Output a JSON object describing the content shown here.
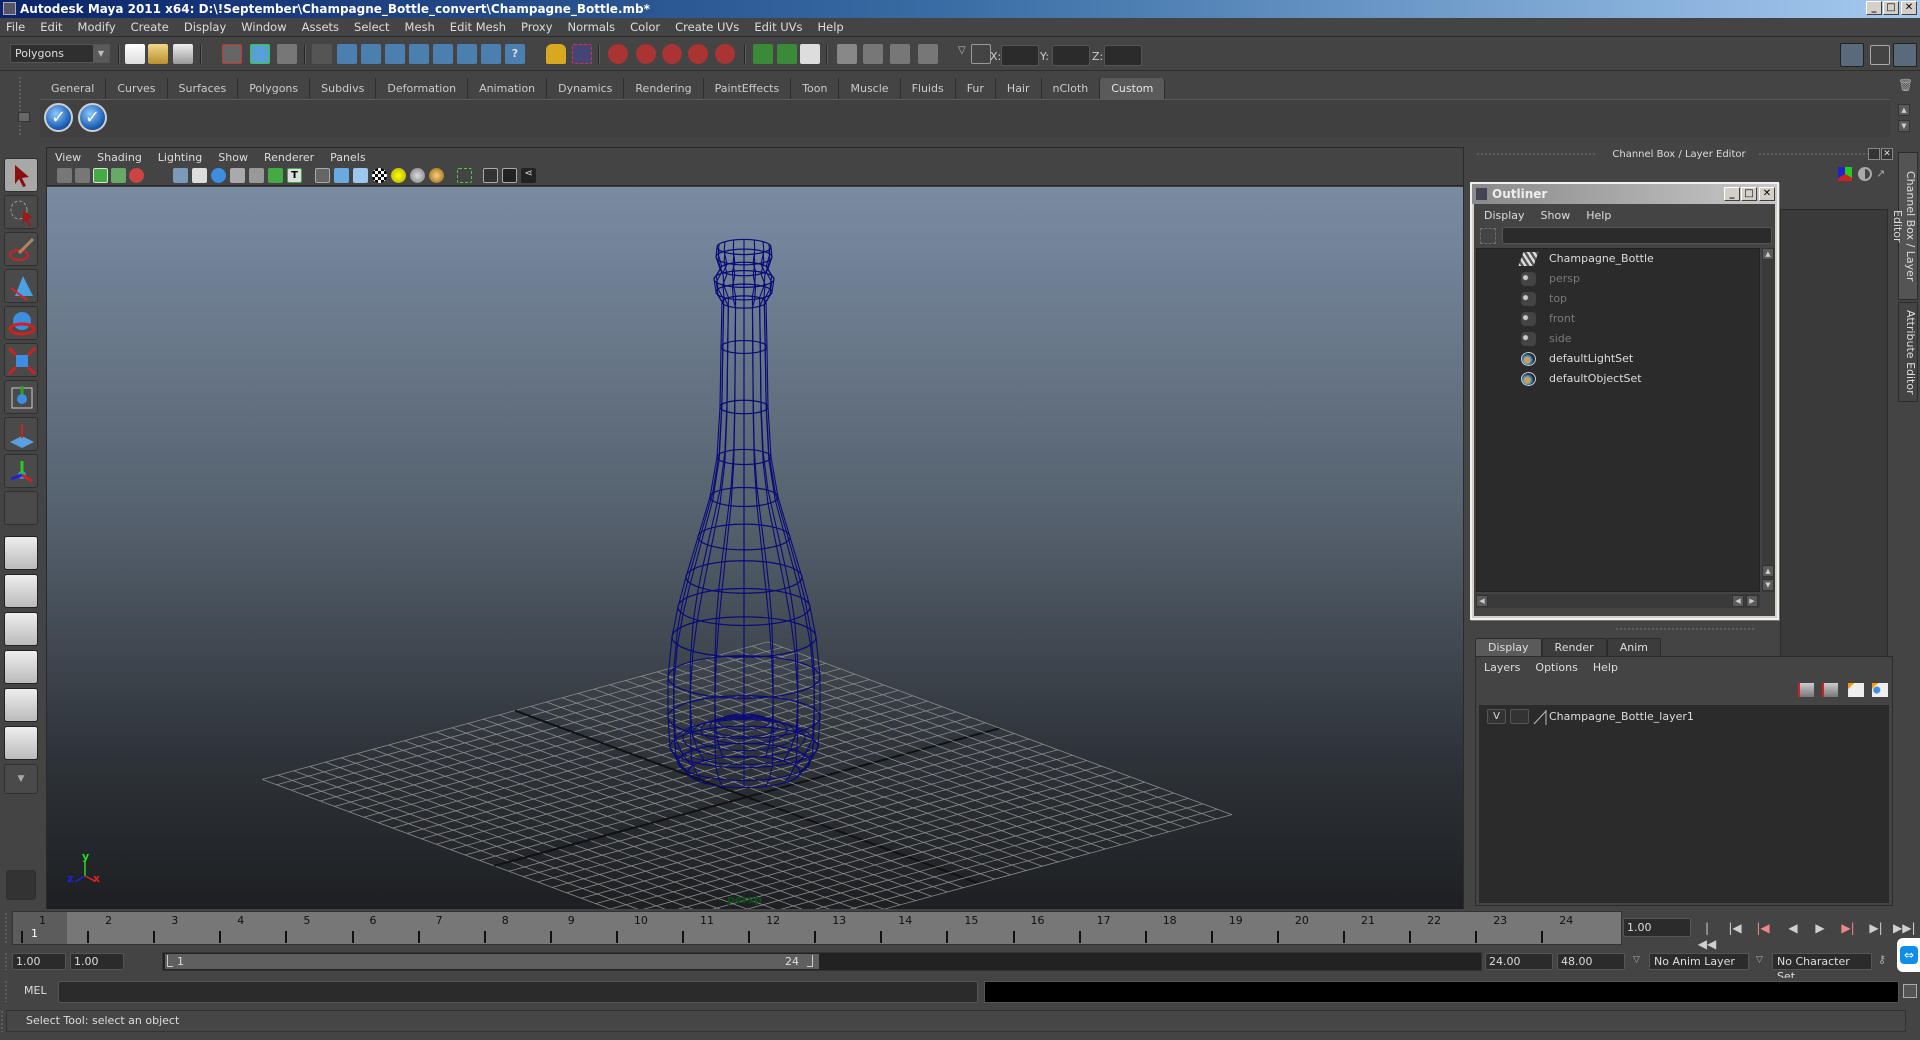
{
  "window": {
    "title": "Autodesk Maya 2011 x64: D:\\!September\\Champagne_Bottle_convert\\Champagne_Bottle.mb*",
    "controls": [
      "_",
      "□",
      "✕"
    ]
  },
  "menubar": [
    "File",
    "Edit",
    "Modify",
    "Create",
    "Display",
    "Window",
    "Assets",
    "Select",
    "Mesh",
    "Edit Mesh",
    "Proxy",
    "Normals",
    "Color",
    "Create UVs",
    "Edit UVs",
    "Help"
  ],
  "statusline": {
    "mode": "Polygons",
    "input_labels": {
      "x": "X:",
      "y": "Y:",
      "z": "Z:"
    },
    "x_value": "",
    "y_value": "",
    "z_value": ""
  },
  "shelf": {
    "tabs": [
      "General",
      "Curves",
      "Surfaces",
      "Polygons",
      "Subdivs",
      "Deformation",
      "Animation",
      "Dynamics",
      "Rendering",
      "PaintEffects",
      "Toon",
      "Muscle",
      "Fluids",
      "Fur",
      "Hair",
      "nCloth",
      "Custom"
    ],
    "active_tab": "Custom",
    "buttons": [
      "check-icon",
      "check-icon"
    ]
  },
  "toolbox": {
    "tools": [
      "select-tool",
      "lasso-tool",
      "paint-select-tool",
      "move-tool",
      "rotate-tool",
      "scale-tool",
      "universal-manipulator",
      "soft-modification-tool",
      "show-manipulator-tool",
      "last-tool-used"
    ],
    "active_tool": "select-tool"
  },
  "viewport": {
    "menu": [
      "View",
      "Shading",
      "Lighting",
      "Show",
      "Renderer",
      "Panels"
    ],
    "camera": "persp",
    "axis_labels": {
      "x": "x",
      "y": "y",
      "z": "z"
    },
    "wire_color": "#0a0a78"
  },
  "channelbox": {
    "header": "Channel Box / Layer Editor"
  },
  "outliner": {
    "title": "Outliner",
    "menu": [
      "Display",
      "Show",
      "Help"
    ],
    "filter_value": "",
    "items": [
      {
        "label": "Champagne_Bottle",
        "icon": "mesh-icon",
        "dim": false
      },
      {
        "label": "persp",
        "icon": "camera-icon",
        "dim": true
      },
      {
        "label": "top",
        "icon": "camera-icon",
        "dim": true
      },
      {
        "label": "front",
        "icon": "camera-icon",
        "dim": true
      },
      {
        "label": "side",
        "icon": "camera-icon",
        "dim": true
      },
      {
        "label": "defaultLightSet",
        "icon": "set-icon",
        "dim": false
      },
      {
        "label": "defaultObjectSet",
        "icon": "set-icon",
        "dim": false
      }
    ]
  },
  "layer_editor": {
    "tabs": [
      "Display",
      "Render",
      "Anim"
    ],
    "active_tab": "Display",
    "menu": [
      "Layers",
      "Options",
      "Help"
    ],
    "layers": [
      {
        "visible": "V",
        "type": "",
        "name": "Champagne_Bottle_layer1"
      }
    ]
  },
  "side_tabs": [
    "Channel Box / Layer Editor",
    "Attribute Editor"
  ],
  "timeslider": {
    "ticks": [
      "1",
      "2",
      "3",
      "4",
      "5",
      "6",
      "7",
      "8",
      "9",
      "10",
      "11",
      "12",
      "13",
      "14",
      "15",
      "16",
      "17",
      "18",
      "19",
      "20",
      "21",
      "22",
      "23",
      "24"
    ],
    "current_frame": "1",
    "current_time": "1.00"
  },
  "rangeslider": {
    "anim_start": "1.00",
    "playback_start": "1.00",
    "bar_start_label": "1",
    "bar_end_label": "24",
    "playback_end": "24.00",
    "anim_end": "48.00",
    "anim_layer": "No Anim Layer",
    "character_set": "No Character Set"
  },
  "commandline": {
    "label": "MEL",
    "value": ""
  },
  "helpline": "Select Tool: select an object"
}
